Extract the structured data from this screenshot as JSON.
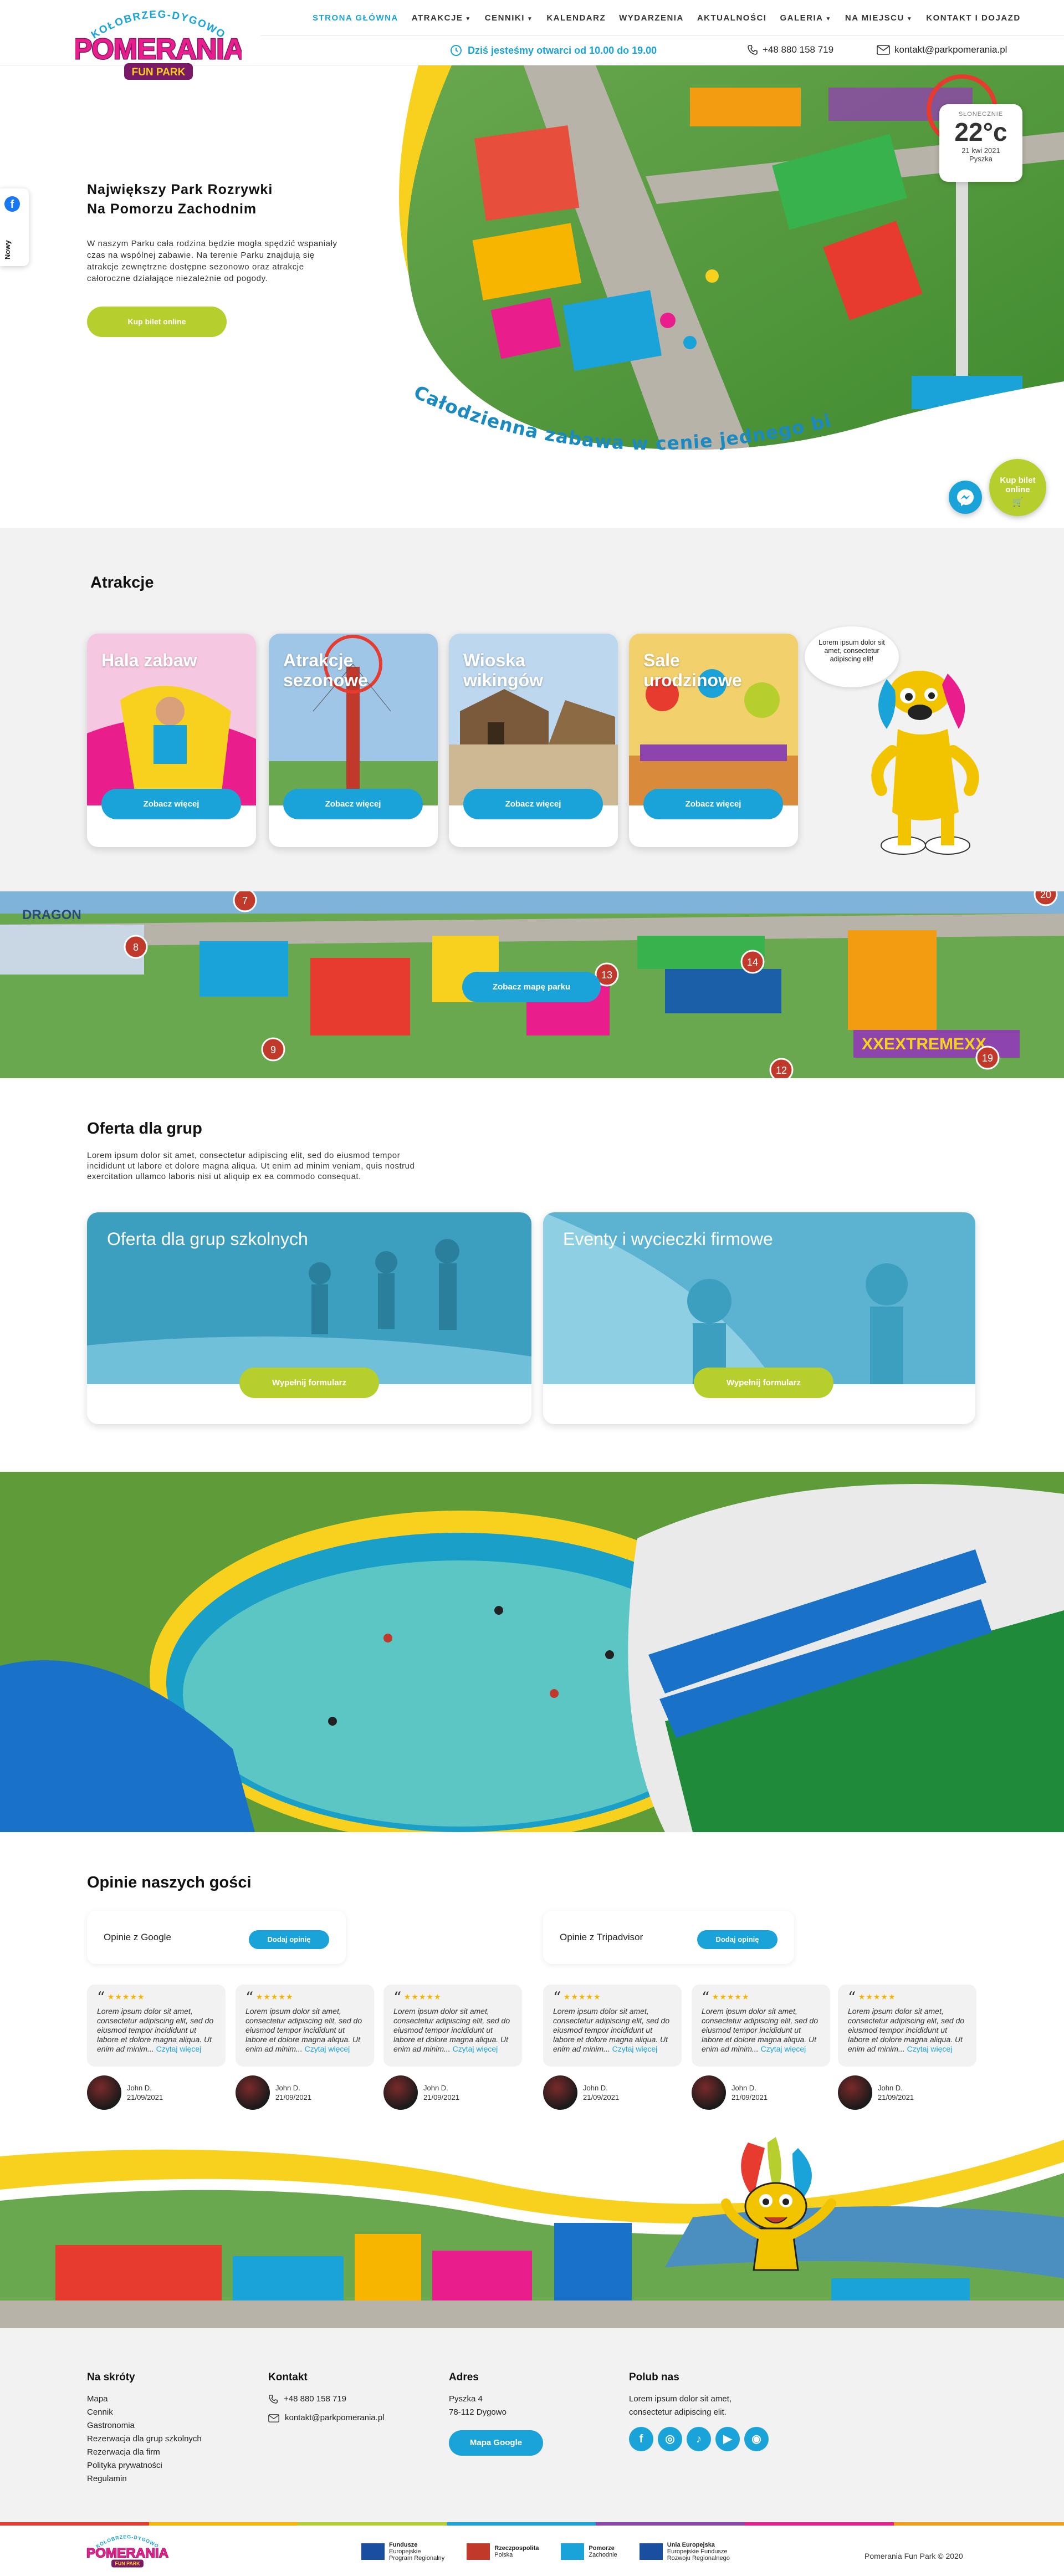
{
  "brand": {
    "logo_top": "KOŁOBRZEG-DYGOWO",
    "logo_main": "POMERANIA",
    "logo_sub": "FUN PARK"
  },
  "nav": {
    "items": [
      {
        "label": "STRONA GŁÓWNA",
        "active": true,
        "dropdown": false
      },
      {
        "label": "ATRAKCJE",
        "active": false,
        "dropdown": true
      },
      {
        "label": "CENNIKI",
        "active": false,
        "dropdown": true
      },
      {
        "label": "KALENDARZ",
        "active": false,
        "dropdown": false
      },
      {
        "label": "WYDARZENIA",
        "active": false,
        "dropdown": false
      },
      {
        "label": "AKTUALNOŚCI",
        "active": false,
        "dropdown": false
      },
      {
        "label": "GALERIA",
        "active": false,
        "dropdown": true
      },
      {
        "label": "NA MIEJSCU",
        "active": false,
        "dropdown": true
      },
      {
        "label": "KONTAKT I DOJAZD",
        "active": false,
        "dropdown": false
      }
    ]
  },
  "topbar": {
    "open_info": "Dziś jesteśmy otwarci od 10.00 do 19.00",
    "phone": "+48 880 158 719",
    "email": "kontakt@parkpomerania.pl"
  },
  "side_tab": {
    "label": "Nowy"
  },
  "hero": {
    "title_line1": "Największy Park Rozrywki",
    "title_line2": "Na Pomorzu Zachodnim",
    "text": "W naszym Parku cała rodzina będzie mogła spędzić wspaniały czas na wspólnej zabawie. Na terenie Parku znajdują się atrakcje zewnętrzne dostępne sezonowo oraz atrakcje całoroczne działające niezależnie od pogody.",
    "button": "Kup bilet online",
    "tagline": "Całodzienna zabawa w cenie jednego biletu!"
  },
  "weather": {
    "label": "SŁONECZNIE",
    "temp": "22°c",
    "date": "21 kwi 2021",
    "place": "Pyszka"
  },
  "floating": {
    "buy_line1": "Kup bilet",
    "buy_line2": "online"
  },
  "attractions": {
    "title": "Atrakcje",
    "cards": [
      {
        "label": "Hala zabaw",
        "button": "Zobacz więcej"
      },
      {
        "label": "Atrakcje sezonowe",
        "button": "Zobacz więcej"
      },
      {
        "label": "Wioska wikingów",
        "button": "Zobacz więcej"
      },
      {
        "label": "Sale urodzinowe",
        "button": "Zobacz więcej"
      }
    ],
    "mascot_bubble": "Lorem ipsum dolor sit amet, consectetur adipiscing elit!"
  },
  "map": {
    "button": "Zobacz mapę parku",
    "pins": [
      "7",
      "8",
      "9",
      "13",
      "14",
      "12",
      "19",
      "20"
    ],
    "signs": [
      "DRAGON",
      "XXEXTREMEXX"
    ]
  },
  "groups": {
    "title": "Oferta dla grup",
    "text": "Lorem ipsum dolor sit amet, consectetur adipiscing elit, sed do eiusmod tempor incididunt ut labore et dolore magna aliqua. Ut enim ad minim veniam, quis nostrud exercitation ullamco laboris nisi ut aliquip ex ea commodo consequat.",
    "cards": [
      {
        "label": "Oferta dla grup szkolnych",
        "button": "Wypełnij formularz"
      },
      {
        "label": "Eventy i wycieczki firmowe",
        "button": "Wypełnij formularz"
      }
    ]
  },
  "reviews": {
    "title": "Opinie naszych gości",
    "google_label": "Opinie z Google",
    "tripadvisor_label": "Opinie z Tripadvisor",
    "add_button": "Dodaj opinię",
    "items": [
      {
        "stars": "★★★★★",
        "text": "Lorem ipsum dolor sit amet, consectetur adipiscing elit, sed do eiusmod tempor incididunt ut labore et dolore magna aliqua. Ut enim ad minim...",
        "more": "Czytaj więcej",
        "name": "John D.",
        "date": "21/09/2021"
      },
      {
        "stars": "★★★★★",
        "text": "Lorem ipsum dolor sit amet, consectetur adipiscing elit, sed do eiusmod tempor incididunt ut labore et dolore magna aliqua. Ut enim ad minim...",
        "more": "Czytaj więcej",
        "name": "John D.",
        "date": "21/09/2021"
      },
      {
        "stars": "★★★★★",
        "text": "Lorem ipsum dolor sit amet, consectetur adipiscing elit, sed do eiusmod tempor incididunt ut labore et dolore magna aliqua. Ut enim ad minim...",
        "more": "Czytaj więcej",
        "name": "John D.",
        "date": "21/09/2021"
      },
      {
        "stars": "★★★★★",
        "text": "Lorem ipsum dolor sit amet, consectetur adipiscing elit, sed do eiusmod tempor incididunt ut labore et dolore magna aliqua. Ut enim ad minim...",
        "more": "Czytaj więcej",
        "name": "John D.",
        "date": "21/09/2021"
      },
      {
        "stars": "★★★★★",
        "text": "Lorem ipsum dolor sit amet, consectetur adipiscing elit, sed do eiusmod tempor incididunt ut labore et dolore magna aliqua. Ut enim ad minim...",
        "more": "Czytaj więcej",
        "name": "John D.",
        "date": "21/09/2021"
      },
      {
        "stars": "★★★★★",
        "text": "Lorem ipsum dolor sit amet, consectetur adipiscing elit, sed do eiusmod tempor incididunt ut labore et dolore magna aliqua. Ut enim ad minim...",
        "more": "Czytaj więcej",
        "name": "John D.",
        "date": "21/09/2021"
      }
    ]
  },
  "footer": {
    "shortcuts_title": "Na skróty",
    "shortcuts": [
      "Mapa",
      "Cennik",
      "Gastronomia",
      "Rezerwacja dla grup szkolnych",
      "Rezerwacja dla firm",
      "Polityka prywatności",
      "Regulamin"
    ],
    "contact_title": "Kontakt",
    "phone": "+48 880 158 719",
    "email": "kontakt@parkpomerania.pl",
    "address_title": "Adres",
    "address_line1": "Pyszka 4",
    "address_line2": "78-112 Dygowo",
    "maps_button": "Mapa Google",
    "social_title": "Polub nas",
    "social_text": "Lorem ipsum dolor sit amet, consectetur adipiscing elit.",
    "copyright": "Pomerania Fun Park © 2020",
    "eu_logos": [
      {
        "line1": "Fundusze",
        "line2": "Europejskie",
        "line3": "Program Regionalny"
      },
      {
        "line1": "Rzeczpospolita",
        "line2": "Polska",
        "line3": ""
      },
      {
        "line1": "Pomorze",
        "line2": "Zachodnie",
        "line3": ""
      },
      {
        "line1": "Unia Europejska",
        "line2": "Europejskie Fundusze",
        "line3": "Rozwoju Regionalnego"
      }
    ]
  },
  "colors": {
    "accent_blue": "#1aa3d9",
    "accent_green": "#b7cf2c",
    "accent_yellow": "#f7d11e"
  }
}
